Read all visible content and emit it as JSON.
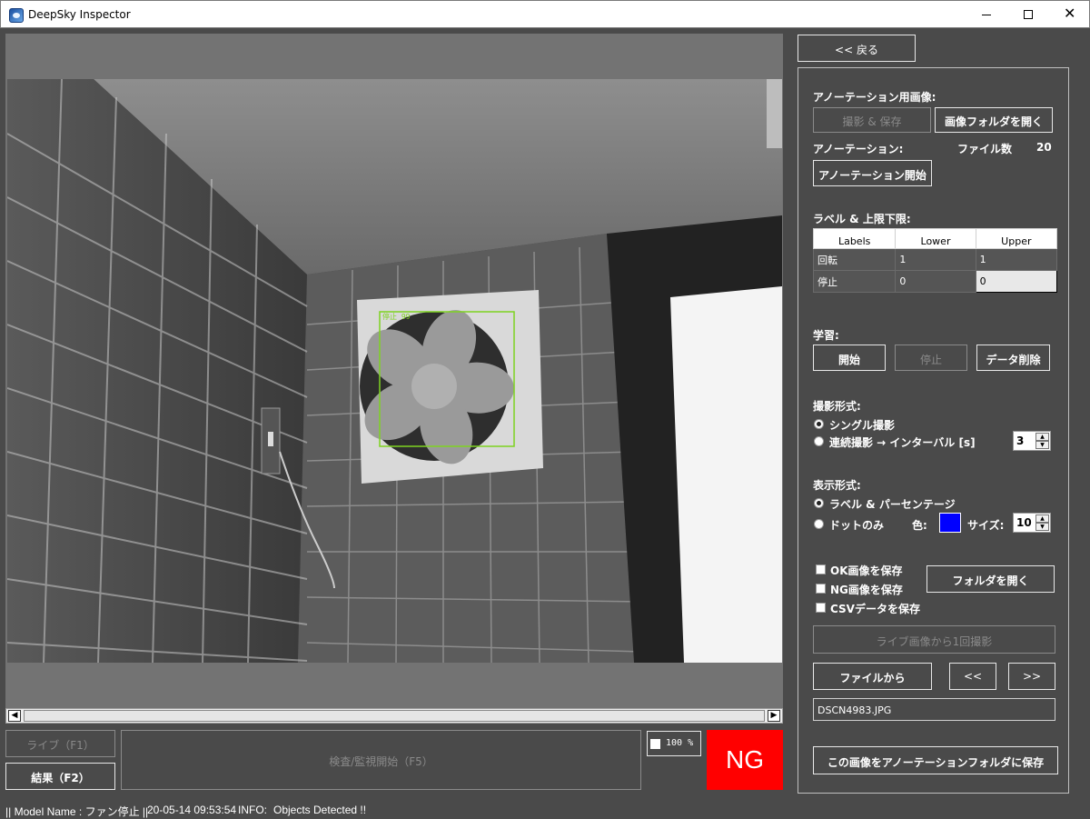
{
  "window": {
    "title": "DeepSky Inspector",
    "min_glyph": "",
    "close_glyph": "✕"
  },
  "viewer": {
    "detection_label": "停止 99",
    "zoom_label": "100 %",
    "result_badge": "NG",
    "result_color": "#ff0000",
    "box_color": "#7ed321"
  },
  "controls": {
    "live_label": "ライブ（F1）",
    "result_label": "結果（F2）",
    "inspect_label": "検査/監視開始（F5）"
  },
  "status": {
    "model": "|| Model Name : ファン停止 ||",
    "timestamp": "20-05-14 09:53:54",
    "info_key": "INFO:",
    "info_value": "Objects Detected !!"
  },
  "panel": {
    "back_label": "<< 戻る",
    "annot_image_heading": "アノーテーション用画像:",
    "capture_save_label": "撮影 & 保存",
    "open_image_folder_label": "画像フォルダを開く",
    "annotation_heading": "アノーテーション:",
    "file_count_label": "ファイル数",
    "file_count_value": "20",
    "annotation_start_label": "アノーテーション開始",
    "label_limits_heading": "ラベル & 上限下限:",
    "table": {
      "headers": [
        "Labels",
        "Lower",
        "Upper"
      ],
      "rows": [
        [
          "回転",
          "1",
          "1"
        ],
        [
          "停止",
          "0",
          "0"
        ]
      ]
    },
    "learning_heading": "学習:",
    "learn_start_label": "開始",
    "learn_stop_label": "停止",
    "delete_data_label": "データ削除",
    "capture_mode_heading": "撮影形式:",
    "single_capture_label": "シングル撮影",
    "continuous_capture_label": "連続撮影 → インターバル [s]",
    "interval_value": "3",
    "display_mode_heading": "表示形式:",
    "label_percent_label": "ラベル & パーセンテージ",
    "dots_only_label": "ドットのみ",
    "color_label": "色:",
    "dot_color": "#0000ff",
    "size_label": "サイズ:",
    "size_value": "10",
    "save_ok_label": "OK画像を保存",
    "save_ng_label": "NG画像を保存",
    "save_csv_label": "CSVデータを保存",
    "open_folder_label": "フォルダを開く",
    "capture_once_label": "ライブ画像から1回撮影",
    "from_file_label": "ファイルから",
    "prev_label": "<<",
    "next_label": ">>",
    "filename": "DSCN4983.JPG",
    "save_to_annot_label": "この画像をアノーテーションフォルダに保存"
  }
}
